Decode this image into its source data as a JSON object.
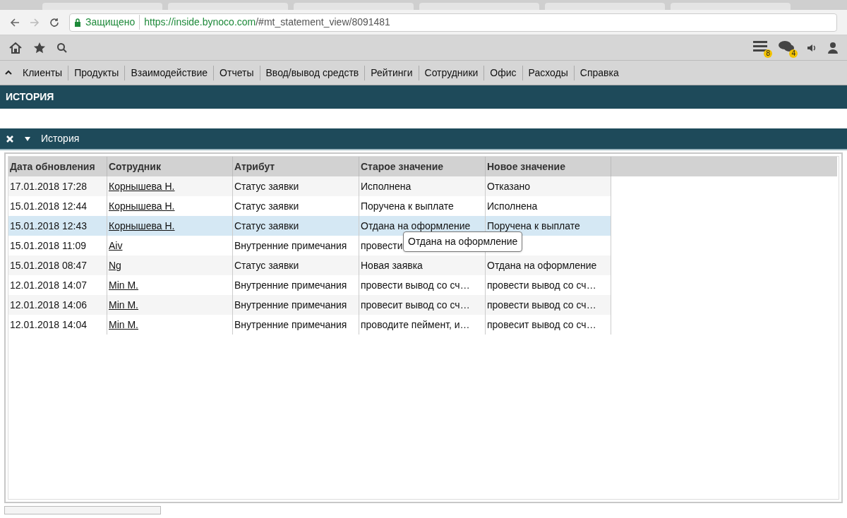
{
  "browser": {
    "secure_label": "Защищено",
    "url_host": "https://inside.bynoco.com",
    "url_path": "/#mt_statement_view/8091481"
  },
  "toolbar": {
    "badges": [
      {
        "kind": "list",
        "count": "8"
      },
      {
        "kind": "chat",
        "count": "4"
      }
    ]
  },
  "menu": {
    "items": [
      "Клиенты",
      "Продукты",
      "Взаимодействие",
      "Отчеты",
      "Ввод/вывод средств",
      "Рейтинги",
      "Сотрудники",
      "Офис",
      "Расходы",
      "Справка"
    ]
  },
  "page_title": "ИСТОРИЯ",
  "panel": {
    "title": "История",
    "expanded": true
  },
  "table": {
    "columns": [
      "Дата обновления",
      "Сотрудник",
      "Атрибут",
      "Старое значение",
      "Новое значение"
    ],
    "rows": [
      {
        "date": "17.01.2018 17:28",
        "employee": "Корнышева Н.",
        "attribute": "Статус заявки",
        "old": "Исполнена",
        "new": "Отказано",
        "selected": false
      },
      {
        "date": "15.01.2018 12:44",
        "employee": "Корнышева Н.",
        "attribute": "Статус заявки",
        "old": "Поручена к выплате",
        "new": "Исполнена",
        "selected": false
      },
      {
        "date": "15.01.2018 12:43",
        "employee": "Корнышева Н.",
        "attribute": "Статус заявки",
        "old": "Отдана на оформление",
        "new": "Поручена к выплате",
        "selected": true
      },
      {
        "date": "15.01.2018 11:09",
        "employee": "Aiv",
        "attribute": "Внутренние примечания",
        "old": "провести",
        "selected": false
      },
      {
        "date": "15.01.2018 08:47",
        "employee": "Ng",
        "attribute": "Статус заявки",
        "old": "Новая заявка",
        "new": "Отдана на оформление",
        "selected": false
      },
      {
        "date": "12.01.2018 14:07",
        "employee": "Min M.",
        "attribute": "Внутренние примечания",
        "old": "провести вывод со сч…",
        "new": "провести вывод со сч…",
        "selected": false
      },
      {
        "date": "12.01.2018 14:06",
        "employee": "Min M.",
        "attribute": "Внутренние примечания",
        "old": "провесит вывод со сч…",
        "new": "провести вывод со сч…",
        "selected": false
      },
      {
        "date": "12.01.2018 14:04",
        "employee": "Min M.",
        "attribute": "Внутренние примечания",
        "old": "проводите пеймент, и…",
        "new": "провесит вывод со сч…",
        "selected": false
      }
    ]
  },
  "tooltip": "Отдана на оформление"
}
